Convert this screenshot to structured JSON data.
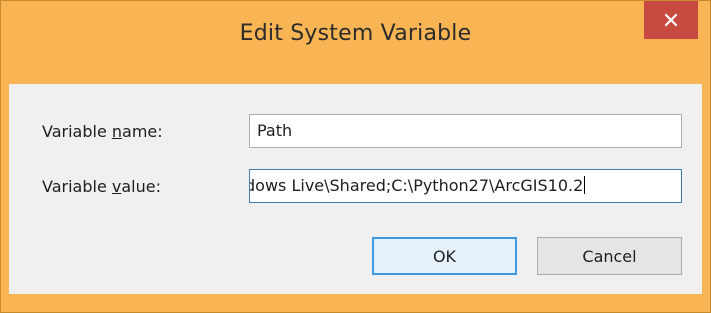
{
  "window": {
    "title": "Edit System Variable",
    "frame_color": "#f9b554",
    "close_color": "#c74a40"
  },
  "form": {
    "name_label_pre": "Variable ",
    "name_label_accel": "n",
    "name_label_post": "ame:",
    "name_value": "Path",
    "value_label_pre": "Variable ",
    "value_label_accel": "v",
    "value_label_post": "alue:",
    "value_value": "dows Live\\Shared;C:\\Python27\\ArcGIS10.2"
  },
  "buttons": {
    "ok_label": "OK",
    "cancel_label": "Cancel"
  },
  "icons": {
    "close": "close-icon"
  }
}
